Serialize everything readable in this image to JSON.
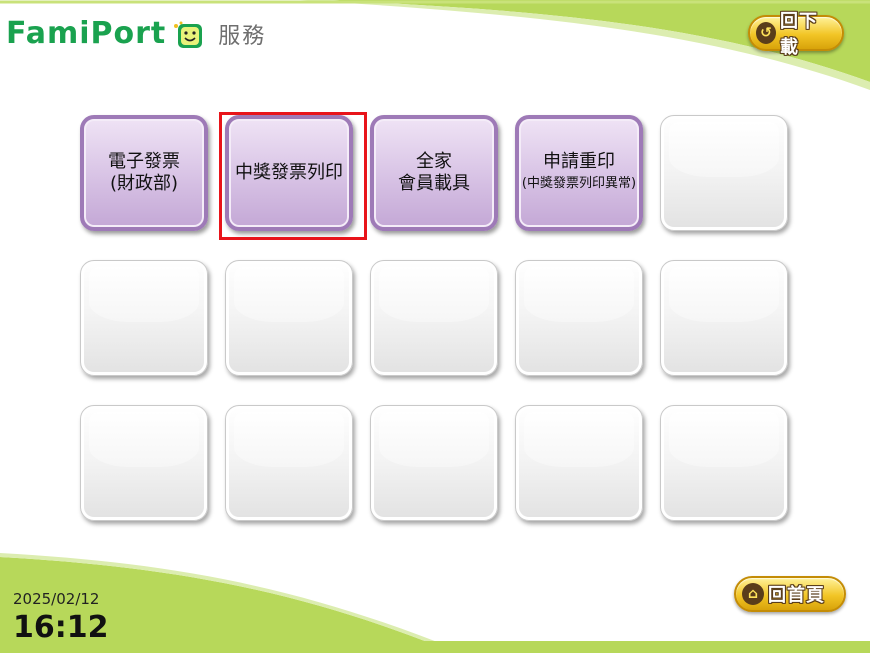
{
  "header": {
    "brand": "FamiPort",
    "title": "服務",
    "back_label": "回下載"
  },
  "tiles": [
    {
      "lines": [
        "電子發票",
        "(財政部)"
      ],
      "active": true
    },
    {
      "lines": [
        "中獎發票列印"
      ],
      "active": true,
      "highlighted": true
    },
    {
      "lines": [
        "全家",
        "會員載具"
      ],
      "active": true
    },
    {
      "lines": [
        "申請重印",
        "(中獎發票列印異常)"
      ],
      "active": true
    },
    {
      "lines": [],
      "active": false
    },
    {
      "lines": [],
      "active": false
    },
    {
      "lines": [],
      "active": false
    },
    {
      "lines": [],
      "active": false
    },
    {
      "lines": [],
      "active": false
    },
    {
      "lines": [],
      "active": false
    },
    {
      "lines": [],
      "active": false
    },
    {
      "lines": [],
      "active": false
    },
    {
      "lines": [],
      "active": false
    },
    {
      "lines": [],
      "active": false
    },
    {
      "lines": [],
      "active": false
    }
  ],
  "footer": {
    "date": "2025/02/12",
    "time": "16:12",
    "home_label": "回首頁"
  },
  "colors": {
    "brand_green": "#1aa24f",
    "wave_green": "#b7d85a",
    "tile_purple": "#9e7ab7",
    "highlight_red": "#e8141a",
    "pill_gold": "#f2c526"
  }
}
